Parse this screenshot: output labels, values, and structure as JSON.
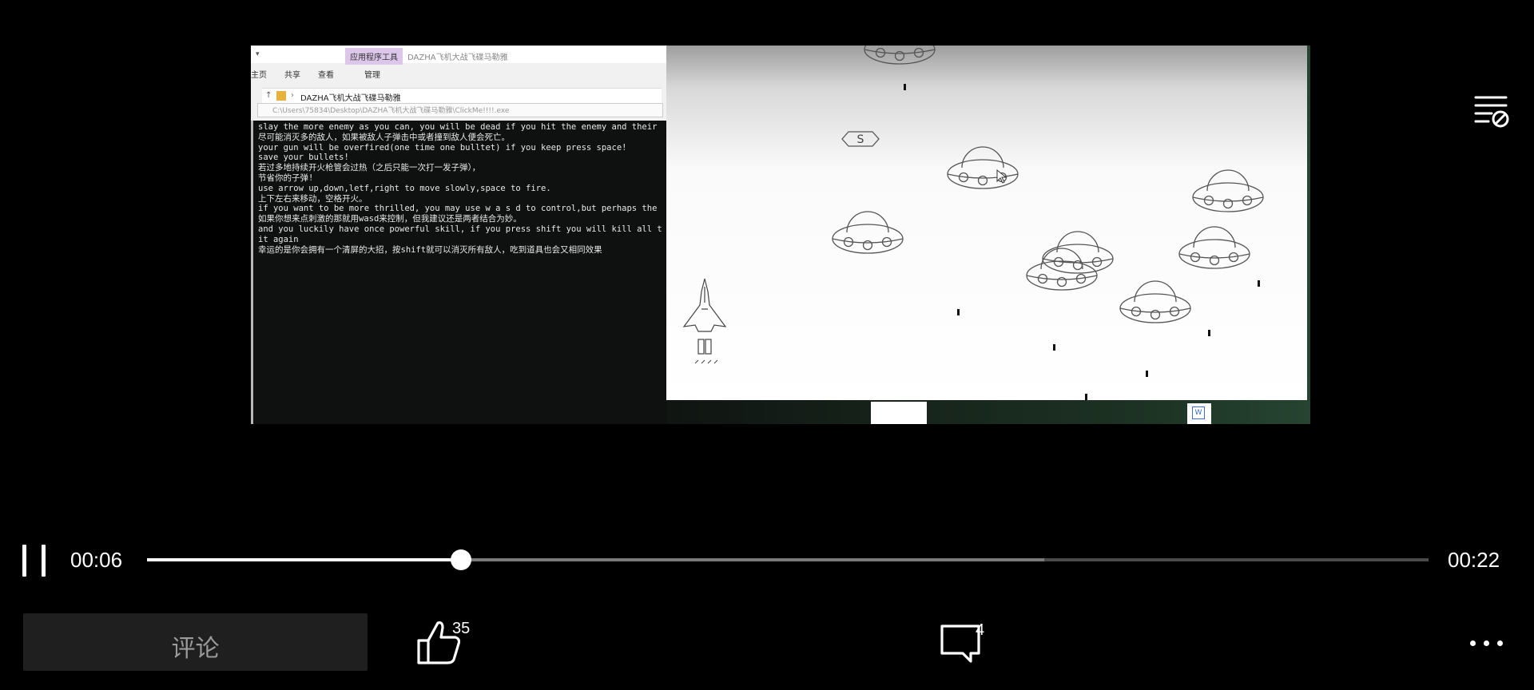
{
  "explorer": {
    "tab_group": "应用程序工具",
    "window_title": "DAZHA飞机大战飞碟马勒雅",
    "tabs": [
      "主页",
      "共享",
      "查看",
      "管理"
    ],
    "breadcrumb": "DAZHA飞机大战飞碟马勒雅",
    "path": "C:\\Users\\75834\\Desktop\\DAZHA飞机大战飞碟马勒雅\\ClickMe!!!!.exe"
  },
  "console_lines": [
    "slay the more enemy as you can, you will be dead if you hit the enemy and their",
    "尽可能消灭多的敌人，如果被敌人子弹击中或者撞到敌人便会死亡。",
    "your gun will be overfired(one time one bulltet) if you keep press space!",
    "save your bullets!",
    "若过多地持续开火枪管会过热（之后只能一次打一发子弹），",
    "节省你的子弹!",
    "use arrow up,down,letf,right to move slowly,space to fire.",
    "上下左右来移动，空格开火。",
    "if you want to be more thrilled, you may use w a s d to control,but perhaps the",
    "如果你想来点刺激的那就用wasd来控制，但我建议还是两者结合为妙。",
    "and you luckily have once powerful skill, if you press shift you will kill all t",
    " it again",
    "幸运的是你会拥有一个清屏的大招，按shift就可以消灭所有敌人，吃到道具也会又相同效果"
  ],
  "game": {
    "bonus_label": "S"
  },
  "player": {
    "current_time": "00:06",
    "total_time": "00:22",
    "progress": 0.2453,
    "buffered": 0.7
  },
  "actions": {
    "comment_placeholder": "评论",
    "likes": "35",
    "comments": "4"
  },
  "icons": {
    "top_right": "playlist-block-icon",
    "pause": "pause-icon",
    "like": "thumbs-up-icon",
    "comment": "comment-bubble-icon",
    "more": "more-dots-icon"
  }
}
